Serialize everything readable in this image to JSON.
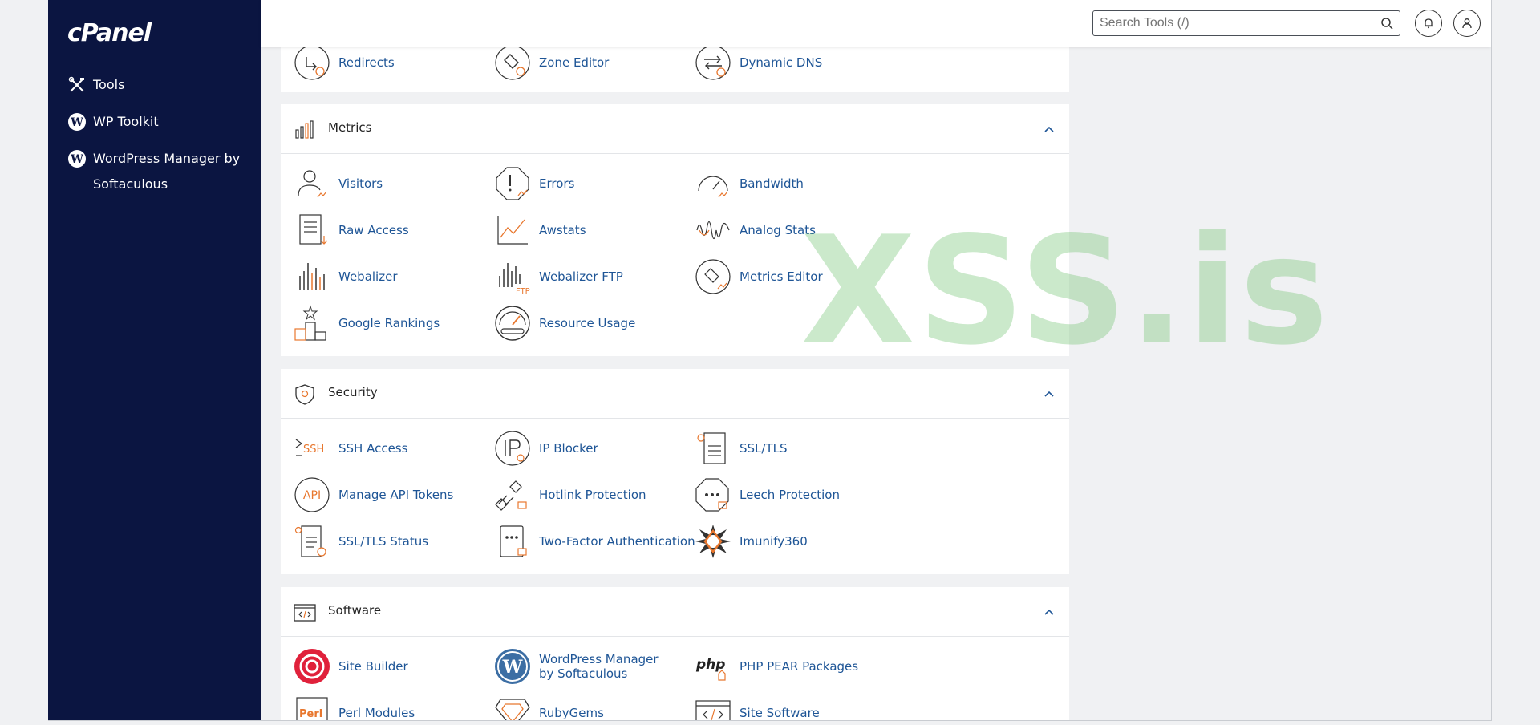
{
  "sidebar": {
    "logo": "cPanel",
    "items": [
      {
        "label": "Tools"
      },
      {
        "label": "WP Toolkit"
      },
      {
        "label": "WordPress Manager by Softaculous"
      }
    ]
  },
  "topbar": {
    "search_placeholder": "Search Tools (/)"
  },
  "domains_partial": {
    "tools": [
      "Redirects",
      "Zone Editor",
      "Dynamic DNS"
    ]
  },
  "metrics": {
    "title": "Metrics",
    "tools": [
      "Visitors",
      "Errors",
      "Bandwidth",
      "Raw Access",
      "Awstats",
      "Analog Stats",
      "Webalizer",
      "Webalizer FTP",
      "Metrics Editor",
      "Google Rankings",
      "Resource Usage"
    ]
  },
  "security": {
    "title": "Security",
    "tools": [
      "SSH Access",
      "IP Blocker",
      "SSL/TLS",
      "Manage API Tokens",
      "Hotlink Protection",
      "Leech Protection",
      "SSL/TLS Status",
      "Two-Factor Authentication",
      "Imunify360"
    ]
  },
  "software": {
    "title": "Software",
    "tools": [
      "Site Builder",
      "WordPress Manager by Softaculous",
      "PHP PEAR Packages",
      "Perl Modules",
      "RubyGems",
      "Site Software"
    ]
  },
  "icon_text": {
    "ssh": "SSH",
    "api": "API",
    "ftp": "FTP",
    "php": "php",
    "perl": "Perl"
  },
  "watermark": "XSS.is",
  "colors": {
    "sidebar_bg": "#0b1541",
    "link": "#1e5596",
    "accent_orange": "#e8772e",
    "page_bg": "#f0f1f3"
  }
}
